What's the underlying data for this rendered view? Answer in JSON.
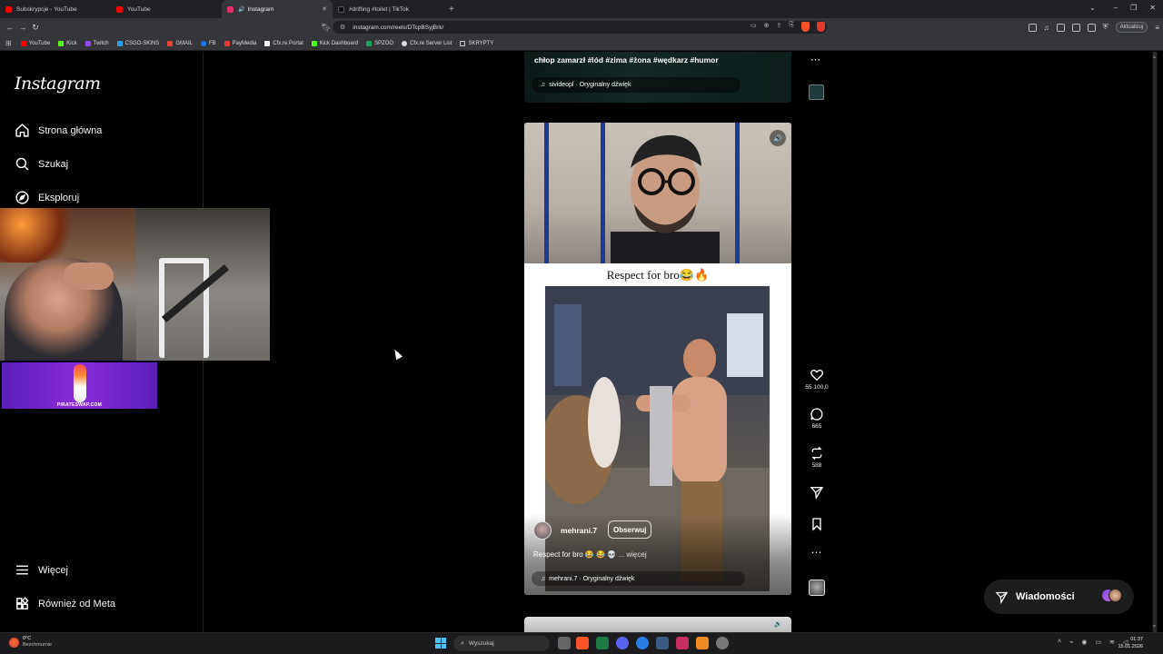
{
  "browser": {
    "tabs": [
      {
        "label": "Subskrypcje - YouTube",
        "color": "#ff0000",
        "active": false
      },
      {
        "label": "YouTube",
        "color": "#ff0000",
        "active": false
      },
      {
        "label": "Instagram",
        "color": "#e1306c",
        "active": true
      },
      {
        "label": "#drifting #toilet | TikTok",
        "color": "#111111",
        "active": false
      }
    ],
    "url": "instagram.com/reels/DTcpBSyjBrk/",
    "update_label": "Aktualizuj",
    "bookmarks": [
      {
        "label": "YouTube",
        "color": "#ff0000"
      },
      {
        "label": "Kick",
        "color": "#53fc18"
      },
      {
        "label": "Twitch",
        "color": "#9146ff"
      },
      {
        "label": "CSGO-SKINS",
        "color": "#2aa1e0"
      },
      {
        "label": "GMAIL",
        "color": "#ea4335"
      },
      {
        "label": "FB",
        "color": "#1877f2"
      },
      {
        "label": "PayMedia",
        "color": "#e53935"
      },
      {
        "label": "Cfx.re Portal",
        "color": "#ffffff"
      },
      {
        "label": "Kick Dashboard",
        "color": "#53fc18"
      },
      {
        "label": "SPZOO",
        "color": "#1aa260"
      },
      {
        "label": "Cfx.re Server List",
        "color": "#dddddd"
      },
      {
        "label": "SKRYPTY",
        "color": "#cccccc"
      }
    ]
  },
  "sidebar": {
    "logo": "Instagram",
    "items": [
      {
        "label": "Strona główna",
        "icon": "home-icon"
      },
      {
        "label": "Szukaj",
        "icon": "search-icon"
      },
      {
        "label": "Eksploruj",
        "icon": "compass-icon"
      },
      {
        "label": "Więcej",
        "icon": "menu-icon"
      },
      {
        "label": "Również od Meta",
        "icon": "meta-grid-icon"
      }
    ]
  },
  "previous_reel": {
    "caption": "chłop zamarzł #lód #zima #żona #wędkarz #humor",
    "audio": "sivideopl · Oryginalny dźwięk"
  },
  "reel": {
    "overlay_caption": "Respect for bro😂🔥",
    "author": "mehrani.7",
    "follow_label": "Obserwuj",
    "description": "Respect for bro 😂 😂 💀",
    "more_label": "... więcej",
    "audio": "mehrani.7 · Oryginalny dźwięk",
    "likes": "55 100,0",
    "comments": "665",
    "reposts": "588"
  },
  "messages": {
    "label": "Wiadomości"
  },
  "overlay": {
    "ad_text": "PIRATESWAP.COM"
  },
  "taskbar": {
    "weather_temp": "0°C",
    "weather_desc": "Bezchmurnie",
    "search_placeholder": "Wyszukaj",
    "time": "01:37",
    "date": "15.01.2026"
  }
}
